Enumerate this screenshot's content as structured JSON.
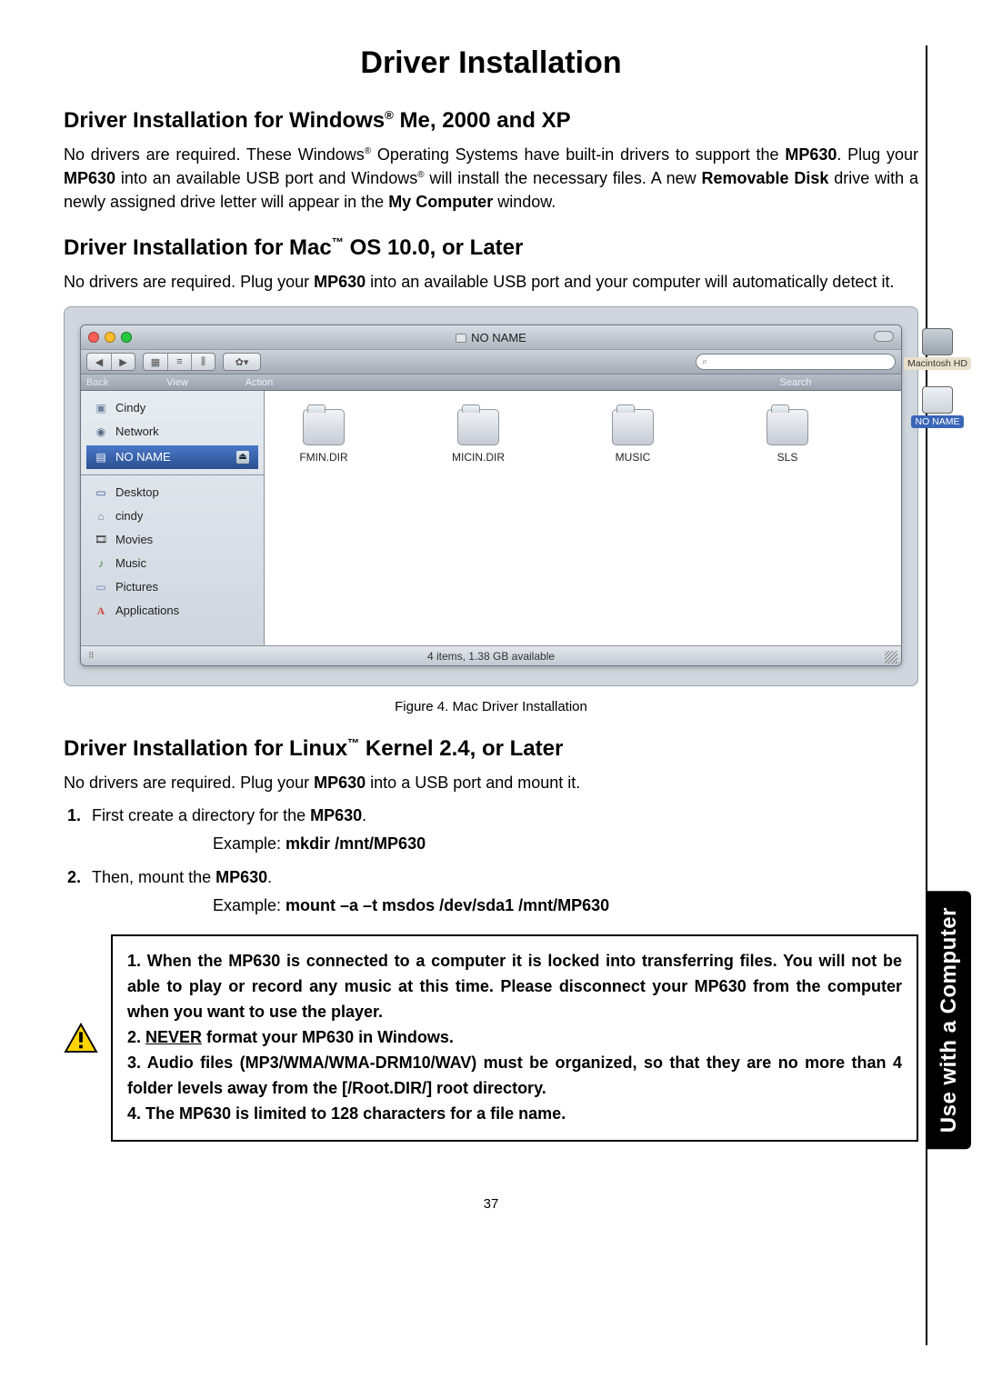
{
  "title": "Driver Installation",
  "side_tab": "Use with a Computer",
  "page_number": "37",
  "sec1": {
    "heading_pre": "Driver Installation for Windows",
    "heading_sup": "®",
    "heading_post": " Me, 2000 and XP",
    "p1a": "No drivers are required. These Windows",
    "p1_sup1": "®",
    "p1b": " Operating Systems have built-in drivers to support the ",
    "p1_bold1": "MP630",
    "p1c": ". Plug your ",
    "p1_bold2": "MP630",
    "p1d": " into an available USB port and Windows",
    "p1_sup2": "®",
    "p1e": " will install the necessary files. A new ",
    "p1_bold3": "Removable Disk",
    "p1f": " drive with a newly assigned drive letter will appear in the ",
    "p1_bold4": "My Computer",
    "p1g": " window."
  },
  "sec2": {
    "heading_pre": "Driver Installation for Mac",
    "heading_sup": "™",
    "heading_post": " OS 10.0, or Later",
    "p1a": "No drivers are required. Plug your ",
    "p1_bold1": "MP630",
    "p1b": " into an available USB port and your computer will automatically detect it."
  },
  "mac": {
    "window_title": "NO NAME",
    "toolbar": {
      "back": "Back",
      "view": "View",
      "action": "Action",
      "search": "Search"
    },
    "status": "4 items, 1.38 GB available",
    "sidebar": {
      "cindy": "Cindy",
      "network": "Network",
      "noname": "NO NAME",
      "desktop": "Desktop",
      "home": "cindy",
      "movies": "Movies",
      "music": "Music",
      "pictures": "Pictures",
      "apps": "Applications"
    },
    "folders": {
      "f1": "FMIN.DIR",
      "f2": "MICIN.DIR",
      "f3": "MUSIC",
      "f4": "SLS"
    },
    "desktop": {
      "hd": "Macintosh HD",
      "noname": "NO NAME"
    }
  },
  "fig_caption": "Figure 4. Mac Driver Installation",
  "sec3": {
    "heading_pre": "Driver Installation for Linux",
    "heading_sup": "™",
    "heading_post": " Kernel 2.4, or Later",
    "p1a": "No drivers are required. Plug your ",
    "p1_bold1": "MP630",
    "p1b": " into a USB port and mount it.",
    "step1a": "First create a directory for the ",
    "step1_bold": "MP630",
    "step1b": ".",
    "ex1_label": "Example: ",
    "ex1_cmd": "mkdir /mnt/MP630",
    "step2a": "Then, mount the ",
    "step2_bold": "MP630",
    "step2b": ".",
    "ex2_label": "Example: ",
    "ex2_cmd": "mount –a –t msdos /dev/sda1 /mnt/MP630"
  },
  "warn": {
    "l1": "1. When the MP630 is connected to a computer it is locked into transferring files. You will not be able to play or record any music at this time. Please disconnect your MP630 from the computer when you want to use the player.",
    "l2a": "2. ",
    "l2u": "NEVER",
    "l2b": " format your MP630 in Windows.",
    "l3": "3. Audio files (MP3/WMA/WMA-DRM10/WAV) must be organized, so that they are no more than 4 folder levels away from the [/Root.DIR/] root directory.",
    "l4": "4. The MP630 is limited to 128 characters for a file name."
  }
}
